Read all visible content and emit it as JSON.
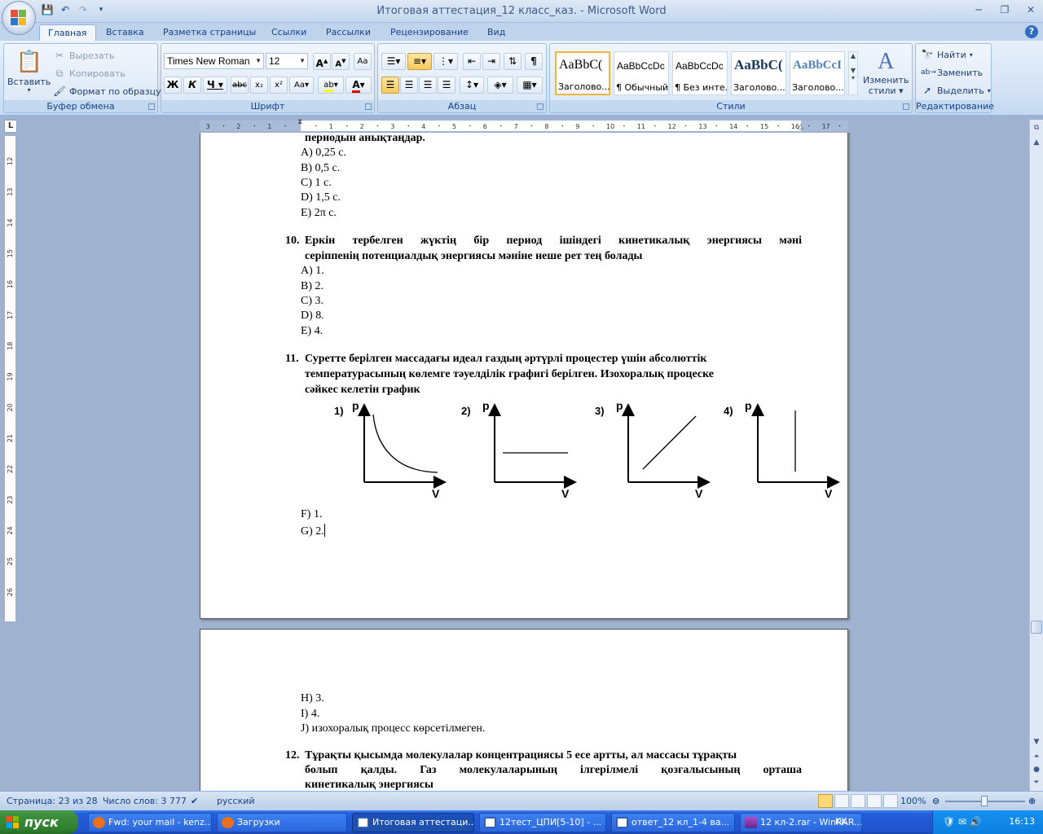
{
  "window": {
    "title": "Итоговая аттестация_12 класс_каз. - Microsoft Word"
  },
  "tabs": [
    "Главная",
    "Вставка",
    "Разметка страницы",
    "Ссылки",
    "Рассылки",
    "Рецензирование",
    "Вид"
  ],
  "ribbon": {
    "clipboard": {
      "label": "Буфер обмена",
      "paste": "Вставить",
      "cut": "Вырезать",
      "copy": "Копировать",
      "format_painter": "Формат по образцу"
    },
    "font": {
      "label": "Шрифт",
      "font_name": "Times New Roman",
      "font_size": "12"
    },
    "paragraph": {
      "label": "Абзац"
    },
    "styles": {
      "label": "Стили",
      "items": [
        {
          "sample": "AaBbC(",
          "name": "Заголово..."
        },
        {
          "sample": "AaBbCcDc",
          "name": "¶ Обычный"
        },
        {
          "sample": "AaBbCcDc",
          "name": "¶ Без инте..."
        },
        {
          "sample": "AaBbC(",
          "name": "Заголово..."
        },
        {
          "sample": "AaBbCcI",
          "name": "Заголово..."
        }
      ],
      "change_styles_line1": "Изменить",
      "change_styles_line2": "стили"
    },
    "editing": {
      "label": "Редактирование",
      "find": "Найти",
      "replace": "Заменить",
      "select": "Выделить"
    }
  },
  "document": {
    "page1": {
      "prev_line": "периодын анықтаңдар.",
      "answers9": [
        "A) 0,25 с.",
        "B) 0,5 с.",
        "C) 1 с.",
        "D) 1,5 с.",
        "E) 2π с."
      ],
      "q10_num": "10.",
      "q10_line1": "Еркін тербелген жүктің бір период ішіндегі кинетикалық энергиясы мәні",
      "q10_line2": "серіппенің потенциалдық энергиясы мәніне неше рет тең болады",
      "answers10": [
        "A) 1.",
        "B) 2.",
        "C) 3.",
        "D) 8.",
        "E) 4."
      ],
      "q11_num": "11.",
      "q11_line1": "Суретте берілген массадағы идеал газдың әртүрлі процестер үшін абсолюттік",
      "q11_line2": "температурасының көлемге тәуелділік графигі берілген. Изохоралық процеске",
      "q11_line3": "сәйкес келетін график",
      "graphs": [
        {
          "num": "1)",
          "ylabel": "p",
          "xlabel": "V",
          "kind": "hyperbola"
        },
        {
          "num": "2)",
          "ylabel": "p",
          "xlabel": "V",
          "kind": "horizontal"
        },
        {
          "num": "3)",
          "ylabel": "p",
          "xlabel": "V",
          "kind": "diagonal"
        },
        {
          "num": "4)",
          "ylabel": "p",
          "xlabel": "V",
          "kind": "vertical"
        }
      ],
      "answers11": [
        "F) 1.",
        "G) 2."
      ]
    },
    "page2": {
      "answers11": [
        "H) 3.",
        "I) 4.",
        "J) изохоралық процесс көрсетілмеген."
      ],
      "q12_num": "12.",
      "q12_line1": "Тұрақты қысымда молекулалар концентрациясы 5 есе артты, ал массасы тұрақты",
      "q12_line2": "болып қалды. Газ молекулаларының ілгерілмелі қозғалысының орташа",
      "q12_line3": "кинетикалық энергиясы"
    }
  },
  "statusbar": {
    "page": "Страница: 23 из 28",
    "words": "Число слов: 3 777",
    "language": "русский",
    "zoom": "100%"
  },
  "taskbar": {
    "start": "пуск",
    "items": [
      {
        "label": "Fwd: your mail - kenz...",
        "color": "#e8711f"
      },
      {
        "label": "Загрузки",
        "color": "#e8711f"
      },
      {
        "label": "Итоговая аттестаци...",
        "color": "#2f5fb5"
      },
      {
        "label": "12тест_ЦПИ[5-10] - ...",
        "color": "#2f5fb5"
      },
      {
        "label": "ответ_12 кл_1-4 ва...",
        "color": "#2f5fb5"
      },
      {
        "label": "12 кл-2.rar - WinRAR...",
        "color": "#7a2f8f"
      }
    ],
    "lang": "KK",
    "clock": "16:13"
  }
}
